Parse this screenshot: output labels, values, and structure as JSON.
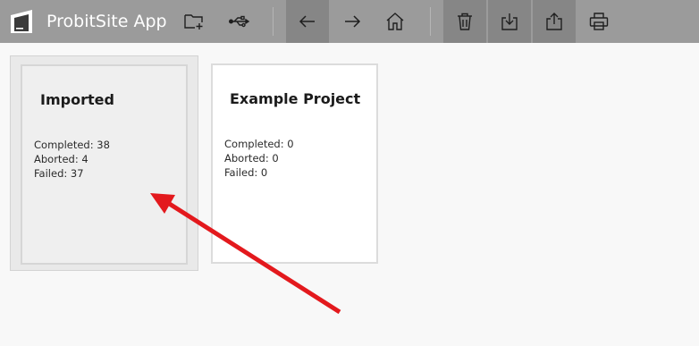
{
  "app": {
    "title": "ProbitSite App"
  },
  "toolbar": {
    "buttons": [
      {
        "icon": "new-folder-icon"
      },
      {
        "icon": "usb-icon"
      },
      {
        "icon": "back-arrow-icon",
        "active": true
      },
      {
        "icon": "forward-arrow-icon"
      },
      {
        "icon": "home-icon"
      },
      {
        "icon": "trash-icon",
        "active": true
      },
      {
        "icon": "download-icon",
        "active": true
      },
      {
        "icon": "share-icon",
        "active": true
      },
      {
        "icon": "print-icon"
      }
    ]
  },
  "projects": [
    {
      "name": "Imported",
      "selected": true,
      "completed_label": "Completed: 38",
      "aborted_label": "Aborted: 4",
      "failed_label": "Failed: 37"
    },
    {
      "name": "Example Project",
      "selected": false,
      "completed_label": "Completed: 0",
      "aborted_label": "Aborted: 0",
      "failed_label": "Failed: 0"
    }
  ],
  "colors": {
    "toolbar_bg": "#9b9b9b",
    "toolbar_active_bg": "#868686",
    "annotation_arrow": "#e3191d"
  }
}
